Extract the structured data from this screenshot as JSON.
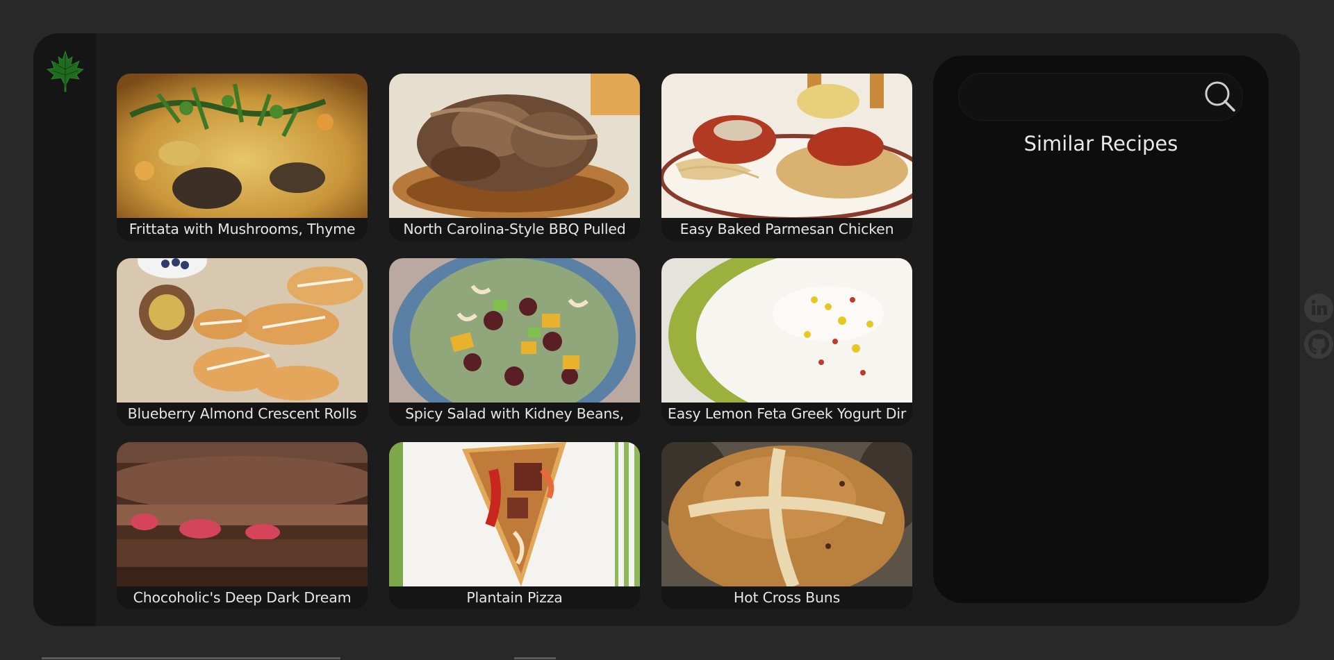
{
  "app": {
    "logo_icon": "maple-leaf-icon",
    "accent_color": "#1f6b1f"
  },
  "recipes": [
    {
      "title": "Frittata with Mushrooms, Thyme",
      "image": "frittata-photo"
    },
    {
      "title": "North Carolina-Style BBQ Pulled",
      "image": "pulled-pork-photo"
    },
    {
      "title": "Easy Baked Parmesan Chicken",
      "image": "parmesan-chicken-photo"
    },
    {
      "title": "Blueberry Almond Crescent Rolls",
      "image": "crescent-rolls-photo"
    },
    {
      "title": "Spicy Salad with Kidney Beans,",
      "image": "kidney-bean-salad-photo"
    },
    {
      "title": "Easy Lemon Feta Greek Yogurt Dir",
      "image": "feta-yogurt-dip-photo"
    },
    {
      "title": "Chocoholic's Deep Dark Dream",
      "image": "chocolate-cake-photo"
    },
    {
      "title": "Plantain Pizza",
      "image": "plantain-pizza-photo"
    },
    {
      "title": "Hot Cross Buns",
      "image": "hot-cross-buns-photo"
    }
  ],
  "sidebar_panel": {
    "search_value": "",
    "search_placeholder": "",
    "search_icon": "search-icon",
    "similar_title": "Similar Recipes"
  },
  "social": {
    "linkedin_icon": "linkedin-icon",
    "github_icon": "github-icon"
  }
}
